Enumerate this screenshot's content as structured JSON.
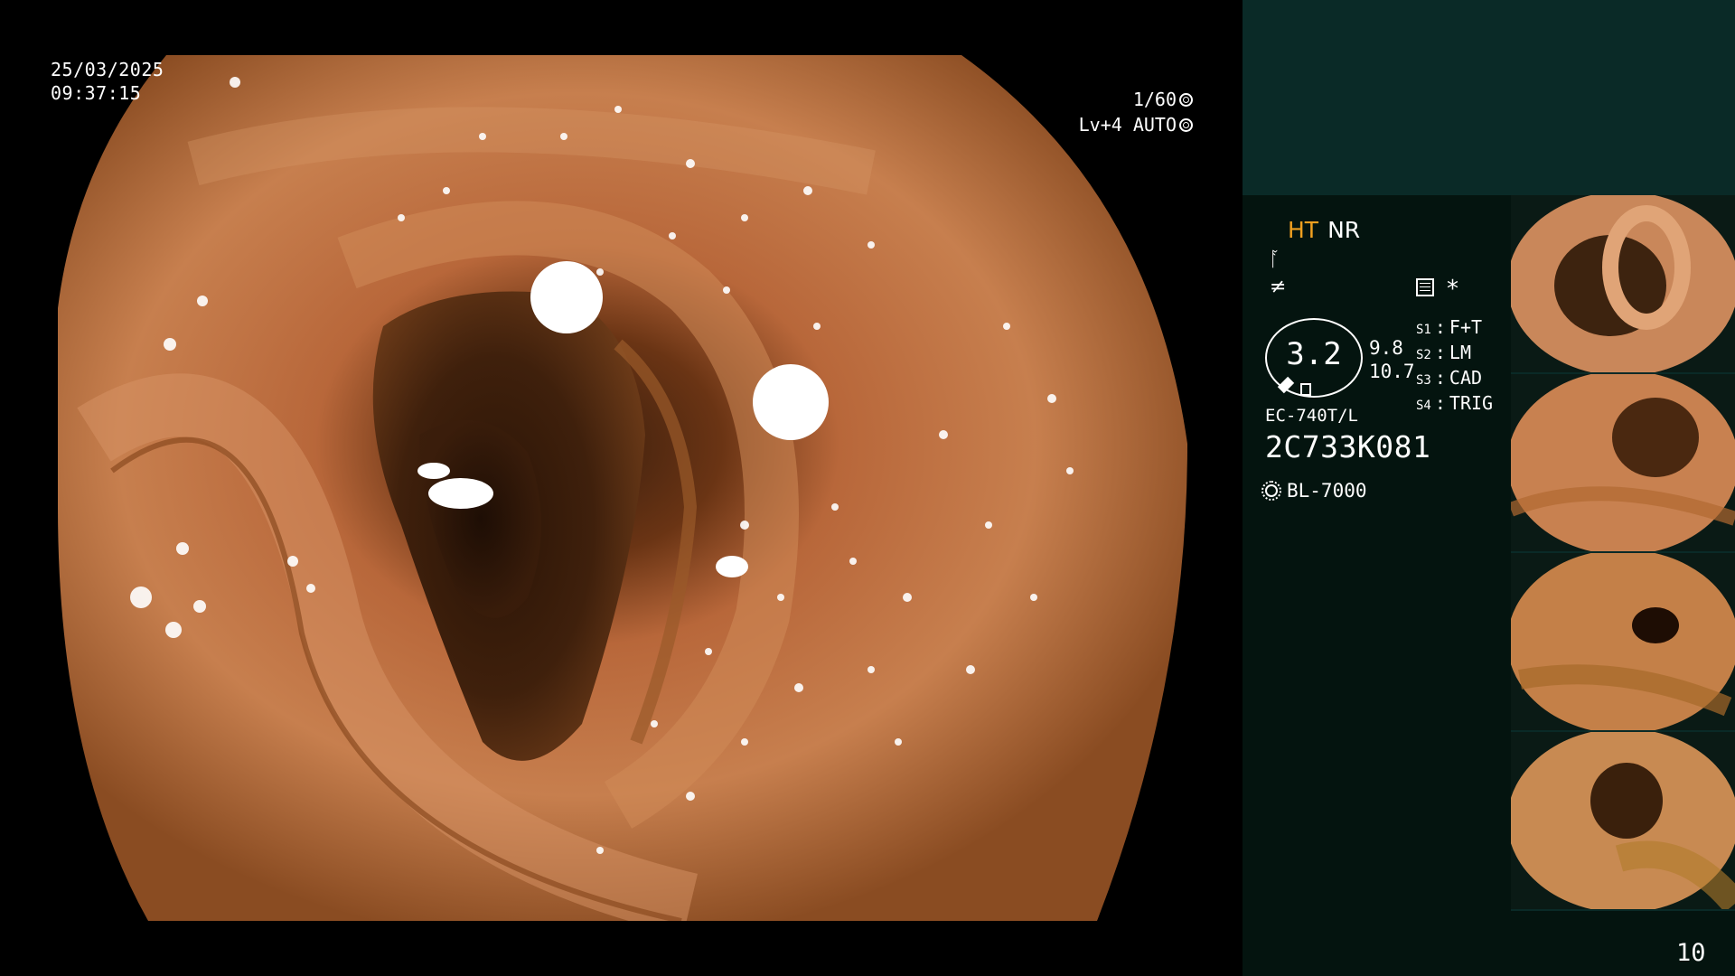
{
  "overlay": {
    "date": "25/03/2025",
    "time": "09:37:15",
    "shutter": "1/60",
    "shutter_icon": "shutter-icon",
    "level": "Lv+4 AUTO",
    "level_icon": "auto-exposure-icon"
  },
  "panel": {
    "mode_ht": "HT",
    "mode_nr": "NR",
    "mode_ht_color": "#f0a020",
    "enhancement_icon": "structure-enhance-icon",
    "contrast_icon": "contrast-icon",
    "record_icon": "record-grid-icon",
    "star": "*",
    "zoom_value": "3.2",
    "mag_a": "9.8",
    "mag_b": "10.7",
    "switches": [
      {
        "label": "S1",
        "value": "F+T"
      },
      {
        "label": "S2",
        "value": "LM"
      },
      {
        "label": "S3",
        "value": "CAD"
      },
      {
        "label": "S4",
        "value": "TRIG"
      }
    ],
    "scope_model": "EC-740T/L",
    "scope_serial": "2C733K081",
    "light_source": "BL-7000",
    "light_icon": "light-source-icon",
    "page_number": "10"
  },
  "thumbnails": [
    {
      "label": "captured-image-1"
    },
    {
      "label": "captured-image-2"
    },
    {
      "label": "captured-image-3"
    },
    {
      "label": "captured-image-4"
    }
  ]
}
